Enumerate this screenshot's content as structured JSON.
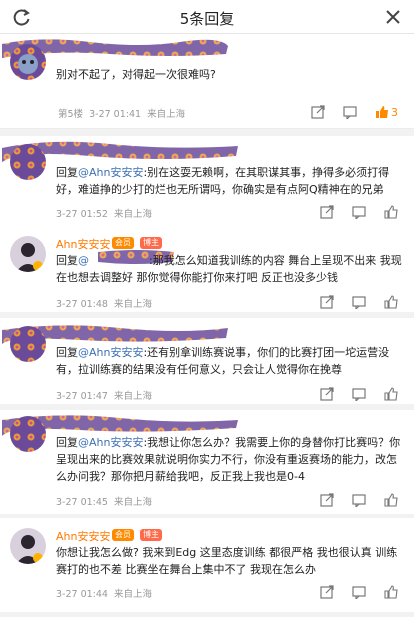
{
  "header": {
    "title": "5条回复"
  },
  "comments": [
    {
      "text": "别对不起了，对得起一次很难吗?",
      "floor": "第5楼",
      "time": "3-27 01:41",
      "location": "来自上海",
      "likes": "3"
    },
    {
      "reply_prefix": "回复",
      "reply_to": "@Ahn安安安",
      "text": ":别在这耍无赖啊，在其职谋其事，挣得多必须打得好，难道挣的少打的烂也无所谓吗，你确实是有点阿Q精神在的兄弟",
      "time": "3-27 01:52",
      "location": "来自上海"
    },
    {
      "name": "Ahn安安安",
      "badge_vip": "会员",
      "badge_blogger": "博主",
      "reply_prefix": "回复",
      "reply_to": "@",
      "text": ":那我怎么知道我训练的内容 舞台上呈现不出来 我现在也想去调整好  那你觉得你能打你来打吧 反正也没多少钱",
      "time": "3-27 01:48",
      "location": "来自上海"
    },
    {
      "reply_prefix": "回复",
      "reply_to": "@Ahn安安安",
      "text": ":还有别拿训练赛说事，你们的比赛打团一坨运营没有，拉训练赛的结果没有任何意义，只会让人觉得你在挽尊",
      "time": "3-27 01:47",
      "location": "来自上海"
    },
    {
      "reply_prefix": "回复",
      "reply_to": "@Ahn安安安",
      "text": ":我想让你怎么办？我需要上你的身替你打比赛吗？你呈现出来的比赛效果就说明你实力不行，你没有重返赛场的能力，改怎么办问我？那你把月薪给我吧，反正我上我也是0-4",
      "time": "3-27 01:45",
      "location": "来自上海"
    },
    {
      "name": "Ahn安安安",
      "badge_vip": "会员",
      "badge_blogger": "博主",
      "text": "你想让我怎么做?  我来到Edg 这里态度训练 都很严格    我也很认真 训练赛打的也不差 比赛坐在舞台上集中不了 我现在怎么办",
      "time": "3-27 01:44",
      "location": "来自上海"
    }
  ]
}
